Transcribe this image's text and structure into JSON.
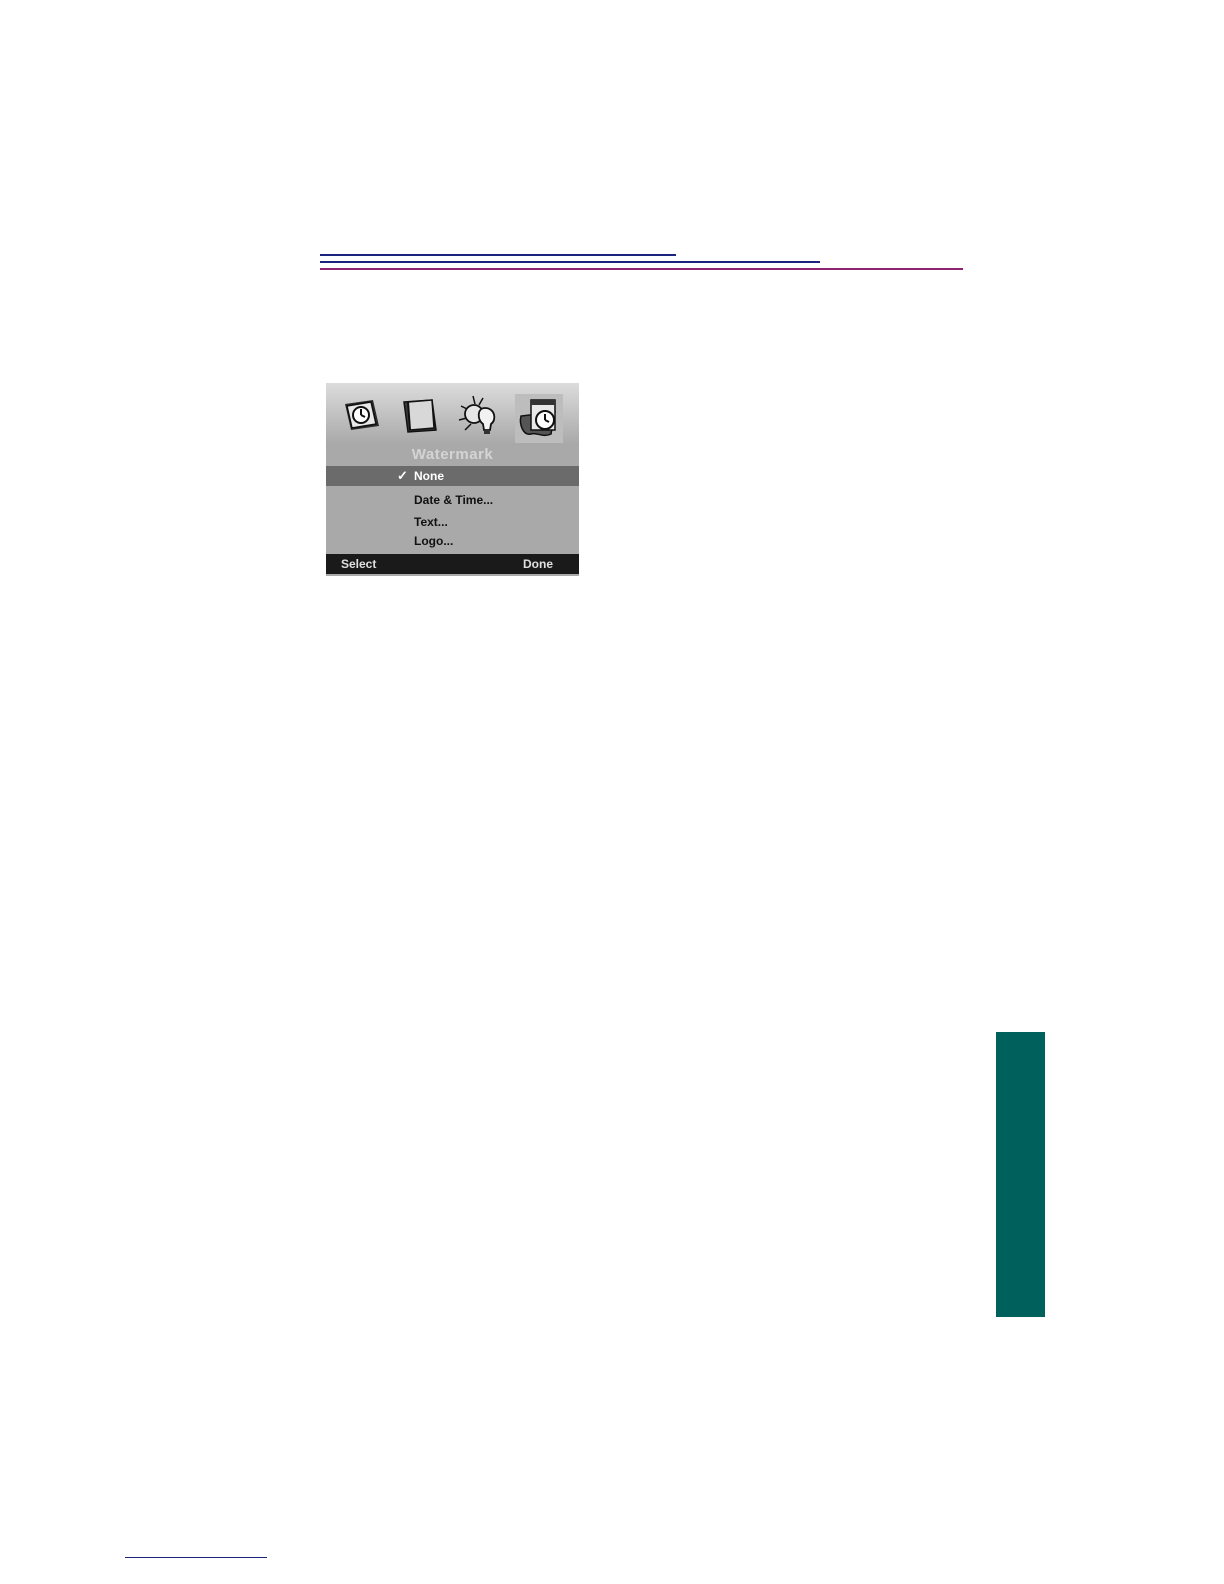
{
  "colors": {
    "rule_blue": "#1a237e",
    "rule_magenta": "#8e2470",
    "side_tab": "#00605c",
    "lcd_background": "#a9a9a9",
    "lcd_highlight": "#6b6b6b",
    "lcd_softkey_bar": "#1a1a1a"
  },
  "camera_screen": {
    "icons": [
      "clock-photo-icon",
      "book-icon",
      "sun-bulb-icon",
      "clock-watermark-icon"
    ],
    "selected_icon": "clock-watermark-icon",
    "menu_title": "Watermark",
    "check_mark": "✓",
    "items": [
      {
        "label": "None",
        "checked": true,
        "highlighted": true
      },
      {
        "label": "Date & Time...",
        "checked": false,
        "highlighted": false
      },
      {
        "label": "Text...",
        "checked": false,
        "highlighted": false
      },
      {
        "label": "Logo...",
        "checked": false,
        "highlighted": false
      }
    ],
    "softkeys": {
      "left": "Select",
      "right": "Done"
    }
  }
}
